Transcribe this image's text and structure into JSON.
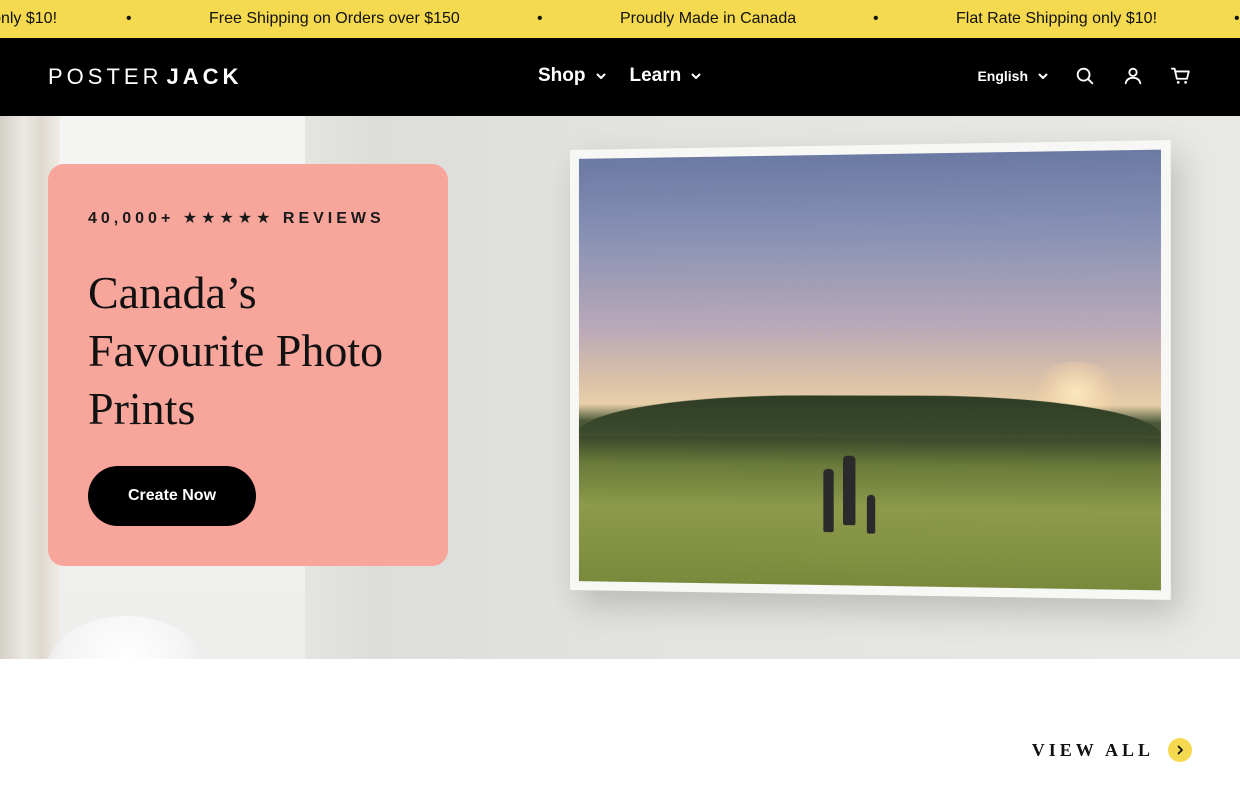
{
  "announcement": {
    "items": [
      "Flat Rate Shipping only $10!",
      "Free Shipping on Orders over $150",
      "Proudly Made in Canada",
      "Flat Rate Shipping only $10!"
    ],
    "separator": "•",
    "background": "#f5d94e"
  },
  "header": {
    "logo_light": "POSTER",
    "logo_bold": "JACK",
    "nav": [
      {
        "label": "Shop"
      },
      {
        "label": "Learn"
      }
    ],
    "language": "English",
    "icons": [
      "search-icon",
      "account-icon",
      "cart-icon"
    ],
    "background": "#000000"
  },
  "hero": {
    "reviews": "40,000+ ★★★★★ REVIEWS",
    "headline": "Canada’s Favourite Photo Prints",
    "cta_label": "Create Now",
    "card_color": "#f8a59b"
  },
  "section": {
    "view_all_label": "VIEW ALL",
    "view_all_icon": "chevron-right-icon"
  }
}
